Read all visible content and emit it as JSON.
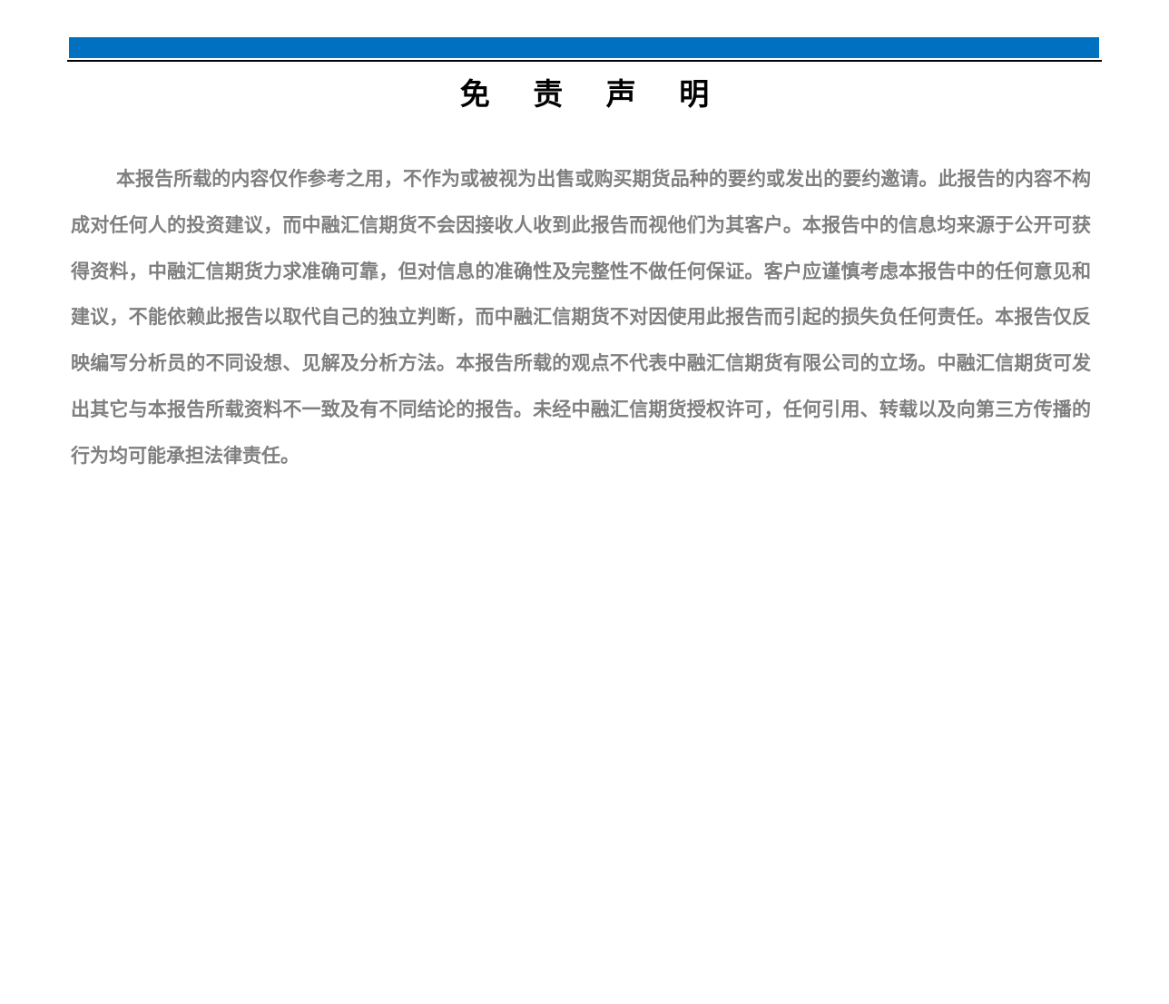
{
  "header": {
    "bar_color": "#0070C0"
  },
  "disclaimer": {
    "title": "免 责 声 明",
    "body": "本报告所载的内容仅作参考之用，不作为或被视为出售或购买期货品种的要约或发出的要约邀请。此报告的内容不构成对任何人的投资建议，而中融汇信期货不会因接收人收到此报告而视他们为其客户。本报告中的信息均来源于公开可获得资料，中融汇信期货力求准确可靠，但对信息的准确性及完整性不做任何保证。客户应谨慎考虑本报告中的任何意见和建议，不能依赖此报告以取代自己的独立判断，而中融汇信期货不对因使用此报告而引起的损失负任何责任。本报告仅反映编写分析员的不同设想、见解及分析方法。本报告所载的观点不代表中融汇信期货有限公司的立场。中融汇信期货可发出其它与本报告所载资料不一致及有不同结论的报告。未经中融汇信期货授权许可，任何引用、转载以及向第三方传播的行为均可能承担法律责任。",
    "text_color": "#7F7F7F"
  }
}
